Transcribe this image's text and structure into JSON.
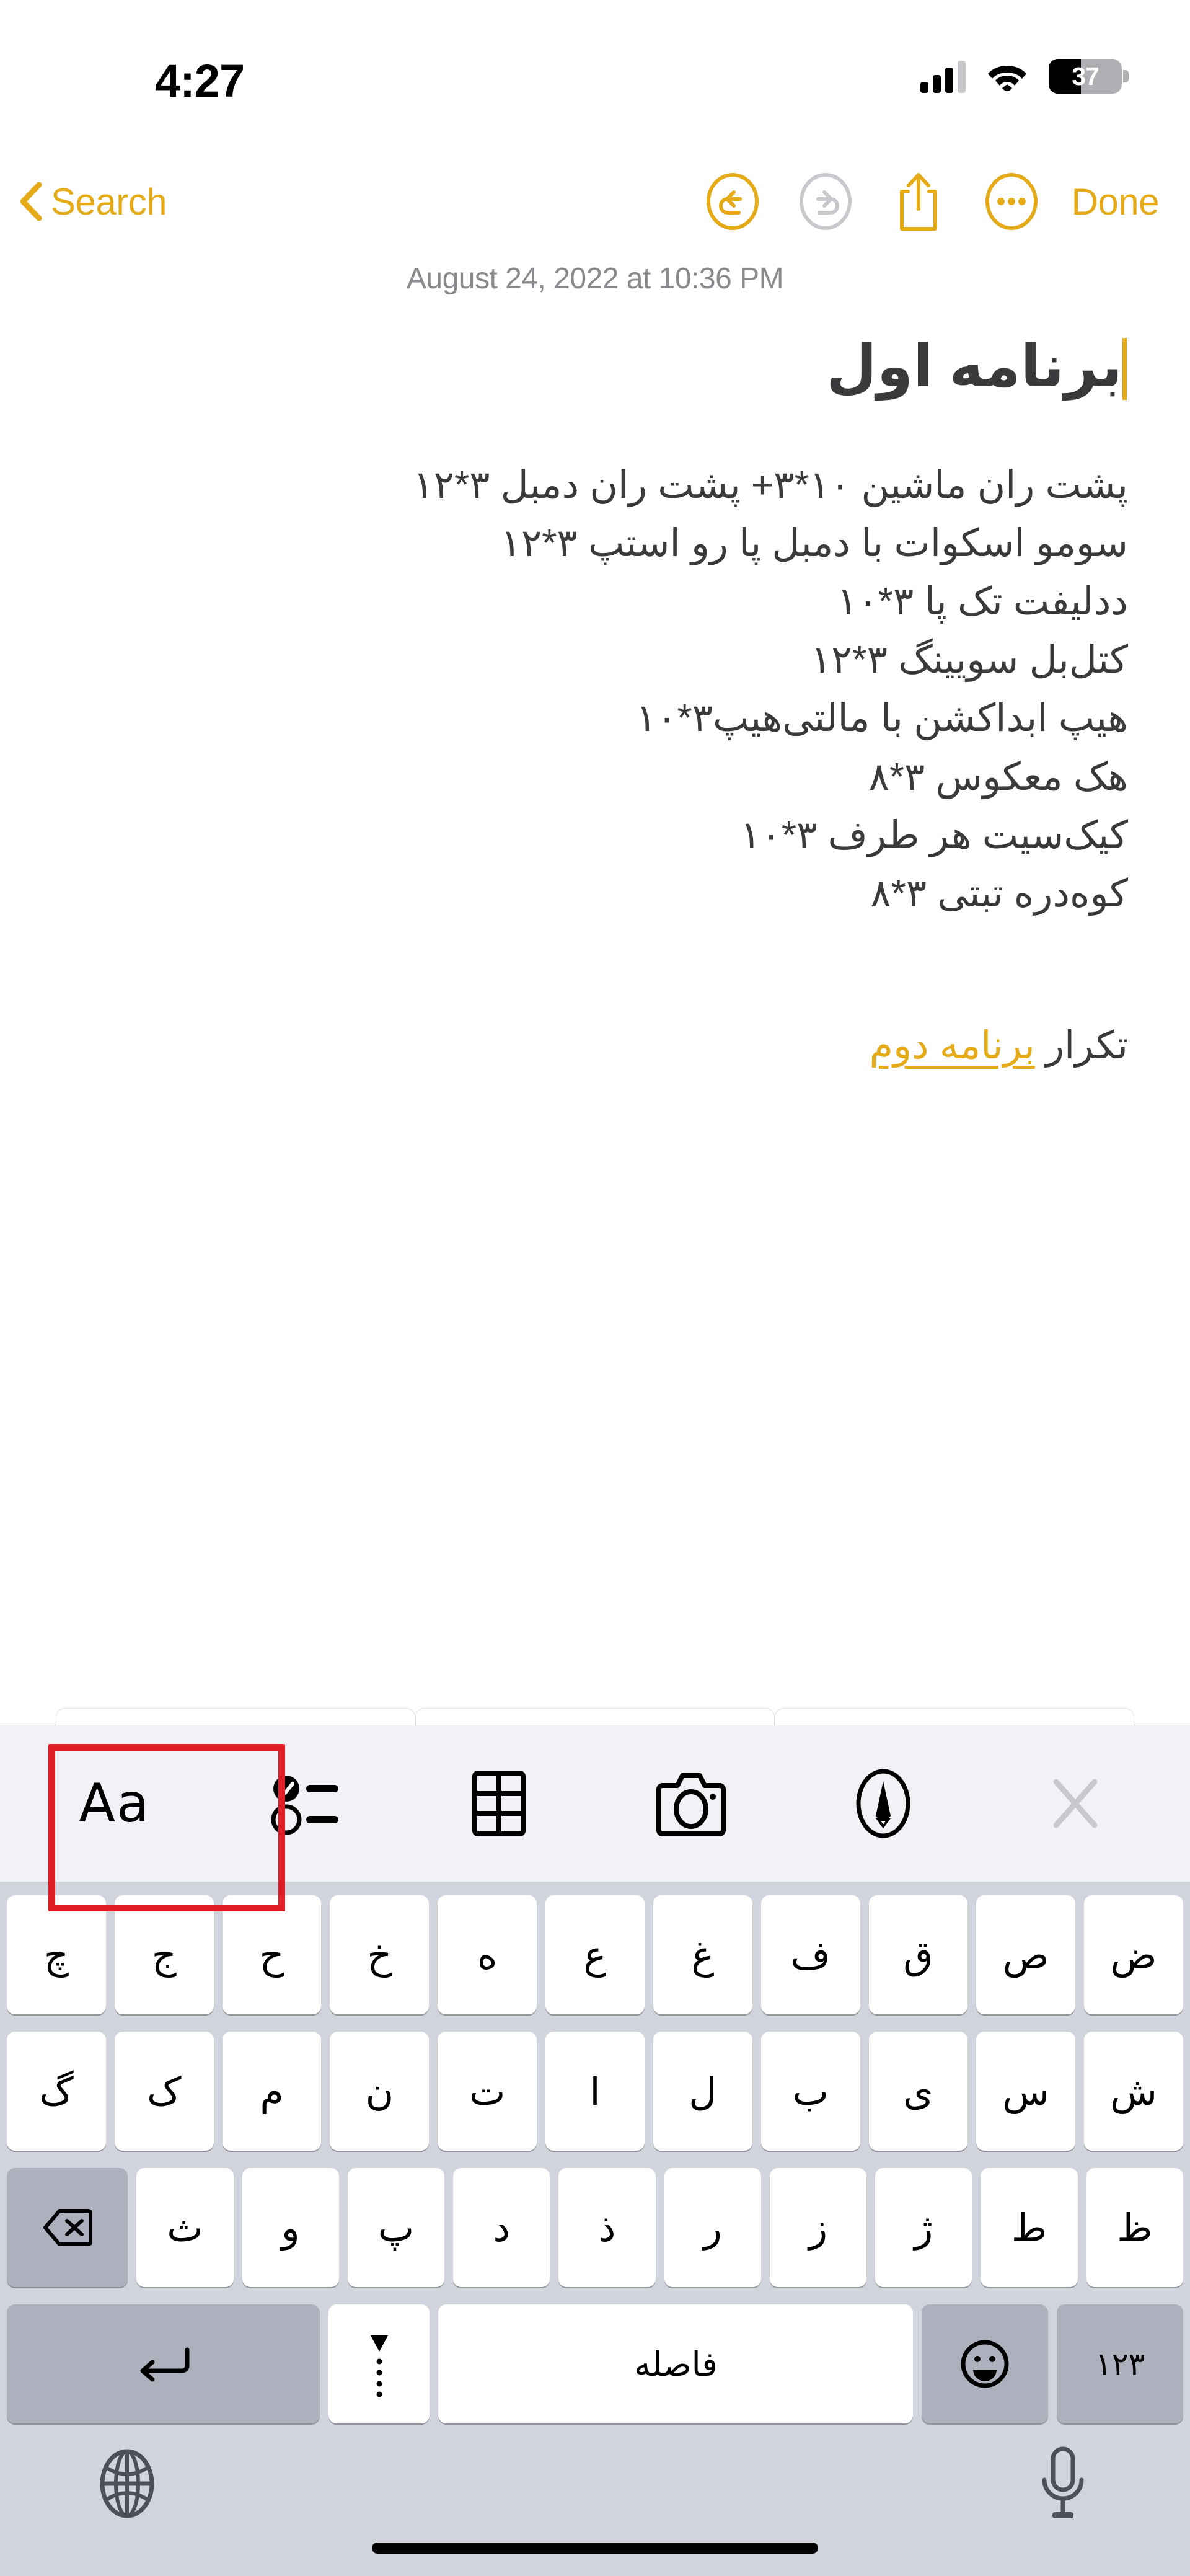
{
  "status_bar": {
    "time": "4:27",
    "signal_icon": "cellular-signal-icon",
    "signal_bars_filled": 3,
    "signal_bars_total": 4,
    "wifi_icon": "wifi-icon",
    "battery_percent": "37",
    "battery_fill_ratio": 0.44,
    "battery_icon": "battery-icon"
  },
  "nav_bar": {
    "back_label": "Search",
    "back_icon": "chevron-left-icon",
    "undo_icon": "undo-icon",
    "undo_enabled": true,
    "redo_icon": "redo-icon",
    "redo_enabled": false,
    "share_icon": "share-icon",
    "more_icon": "more-ellipsis-icon",
    "done_label": "Done"
  },
  "note": {
    "date": "August 24, 2022 at 10:36 PM",
    "title": "برنامه اول",
    "lines": [
      "پشت ران ماشین ۱۰*۳+ پشت ران دمبل ۳*۱۲",
      "سومو اسکوات با دمبل پا رو استپ ۳*۱۲",
      "ددلیفت تک پا ۳*۱۰",
      "کتل‌بل سویینگ   ۳*۱۲",
      "هیپ ابداکشن با مالتی‌هیپ۳*۱۰",
      "هک معکوس ۳*۸",
      "کیک‌سیت هر طرف ۳*۱۰",
      "کوه‌دره تبتی ۳*۸"
    ],
    "footer_prefix": "تکرار ",
    "footer_link": "برنامه دوم"
  },
  "format_toolbar": {
    "items": [
      {
        "label": "Aa",
        "icon": "text-format-icon",
        "highlighted": true
      },
      {
        "label": "",
        "icon": "checklist-icon",
        "highlighted": false
      },
      {
        "label": "",
        "icon": "table-icon",
        "highlighted": false
      },
      {
        "label": "",
        "icon": "camera-icon",
        "highlighted": false
      },
      {
        "label": "",
        "icon": "markup-pen-icon",
        "highlighted": false
      },
      {
        "label": "",
        "icon": "close-x-icon",
        "highlighted": false
      }
    ]
  },
  "keyboard": {
    "language": "Persian",
    "row1": [
      "چ",
      "ج",
      "ح",
      "خ",
      "ه",
      "ع",
      "غ",
      "ف",
      "ق",
      "ص",
      "ض"
    ],
    "row2": [
      "گ",
      "ک",
      "م",
      "ن",
      "ت",
      "ا",
      "ل",
      "ب",
      "ی",
      "س",
      "ش"
    ],
    "row3_letters": [
      "ث",
      "و",
      "پ",
      "د",
      "ذ",
      "ر",
      "ز",
      "ژ",
      "ط",
      "ظ"
    ],
    "backspace_icon": "backspace-delete-icon",
    "numbers_key": "۱۲۳",
    "emoji_icon": "emoji-smiley-icon",
    "space_key": "فاصله",
    "zwnj_icon": "half-space-zwnj-icon",
    "return_icon": "return-key-icon",
    "globe_icon": "globe-language-icon",
    "mic_icon": "microphone-icon"
  },
  "colors": {
    "accent": "#e5aa17",
    "highlight_box": "#e01e26",
    "text": "#3a3a3c",
    "muted": "#8a8a8e",
    "keyboard_bg": "#d1d4dc",
    "toolbar_bg": "#f1f1f6"
  }
}
